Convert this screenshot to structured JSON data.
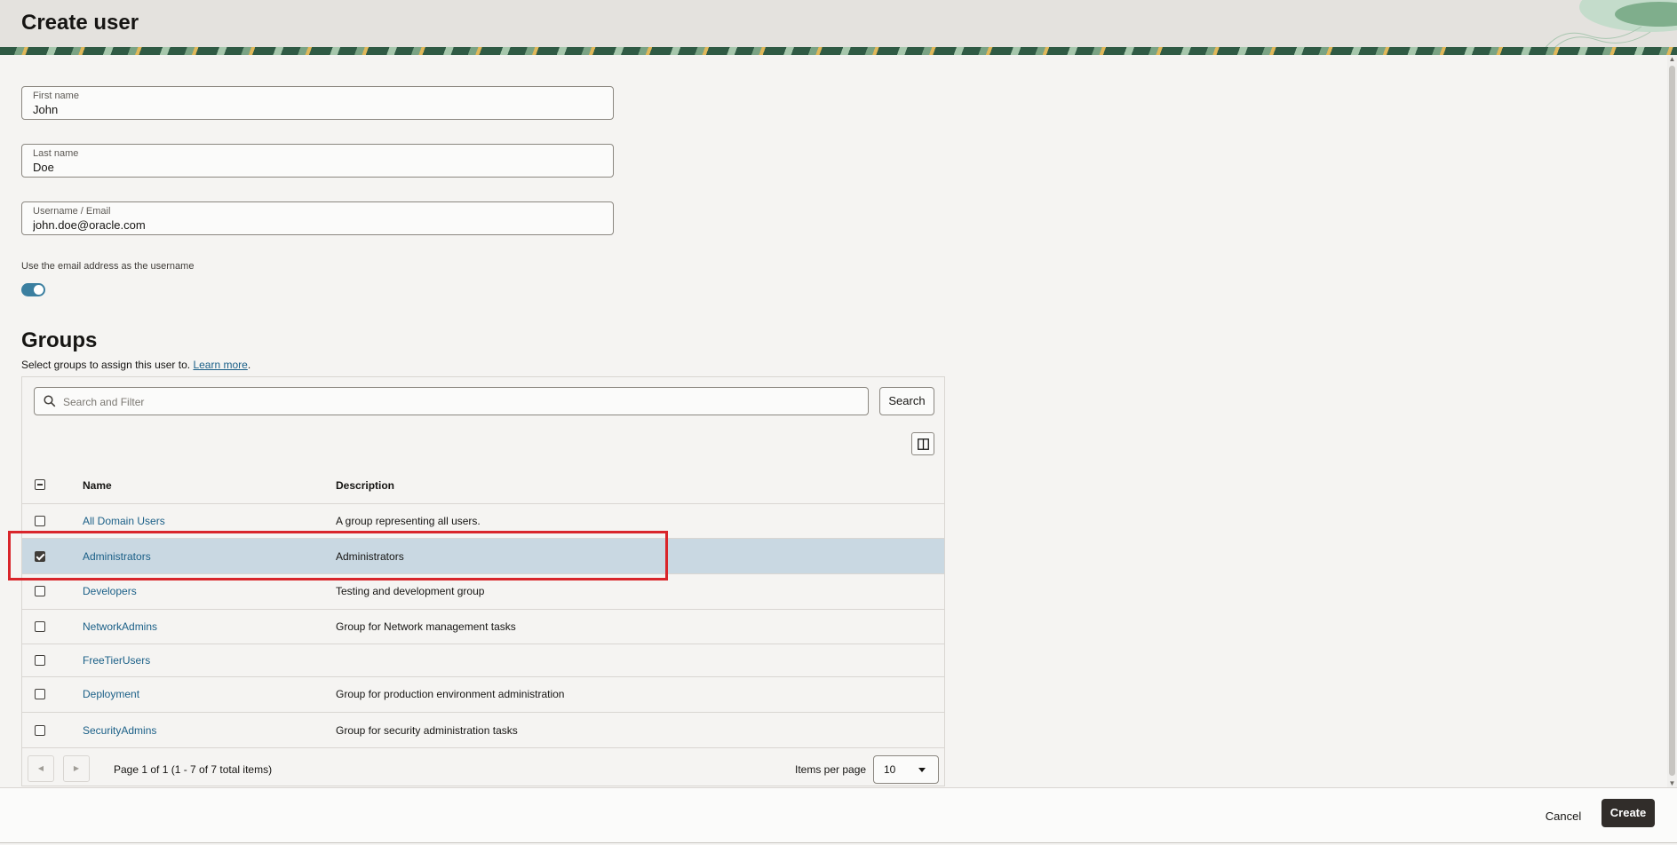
{
  "header": {
    "title": "Create user"
  },
  "form": {
    "first_name": {
      "label": "First name",
      "value": "John"
    },
    "last_name": {
      "label": "Last name",
      "value": "Doe"
    },
    "username": {
      "label": "Username / Email",
      "value": "john.doe@oracle.com"
    },
    "use_email_switch": {
      "label": "Use the email address as the username",
      "on": true
    }
  },
  "groups": {
    "title": "Groups",
    "description": "Select groups to assign this user to.",
    "learn_more": "Learn more",
    "desc_end": ".",
    "search_placeholder": "Search and Filter",
    "search_button": "Search",
    "columns": {
      "name": "Name",
      "description": "Description"
    },
    "rows": [
      {
        "name": "All Domain Users",
        "description": "A group representing all users.",
        "checked": false
      },
      {
        "name": "Administrators",
        "description": "Administrators",
        "checked": true
      },
      {
        "name": "Developers",
        "description": "Testing and development group",
        "checked": false
      },
      {
        "name": "NetworkAdmins",
        "description": "Group for Network management tasks",
        "checked": false
      },
      {
        "name": "FreeTierUsers",
        "description": "",
        "checked": false
      },
      {
        "name": "Deployment",
        "description": "Group for production environment administration",
        "checked": false
      },
      {
        "name": "SecurityAdmins",
        "description": "Group for security administration tasks",
        "checked": false
      }
    ],
    "pager": {
      "text": "Page 1 of 1 (1 - 7 of 7 total items)",
      "items_per_page_label": "Items per page",
      "items_per_page_value": "10"
    }
  },
  "footer": {
    "cancel": "Cancel",
    "create": "Create"
  },
  "colors": {
    "accent": "#1a5f87",
    "selected_row": "#c9d8e2",
    "highlight": "#d9252a",
    "primary_button": "#312d2a"
  }
}
